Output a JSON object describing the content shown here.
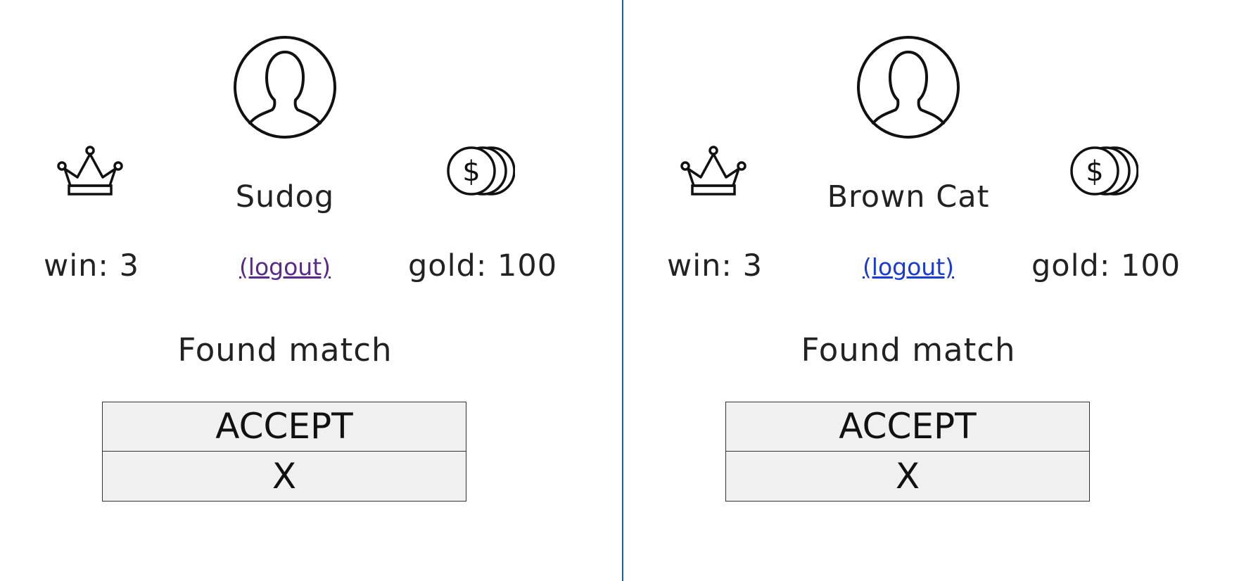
{
  "colors": {
    "divider": "#1f5f96",
    "button_bg": "#f0f0f0",
    "button_border": "#333333",
    "link_visited": "#5a2a8a",
    "link_unvisited": "#1a3bd8"
  },
  "panels": [
    {
      "username": "Sudog",
      "wins_text": "win: 3",
      "gold_text": "gold: 100",
      "logout_label": "(logout)",
      "status": "Found match",
      "accept_label": "ACCEPT",
      "decline_label": "X",
      "icons": {
        "avatar": "user-avatar-icon",
        "crown": "crown-icon",
        "coins": "coins-icon"
      }
    },
    {
      "username": "Brown Cat",
      "wins_text": "win: 3",
      "gold_text": "gold: 100",
      "logout_label": "(logout)",
      "status": "Found match",
      "accept_label": "ACCEPT",
      "decline_label": "X",
      "icons": {
        "avatar": "user-avatar-icon",
        "crown": "crown-icon",
        "coins": "coins-icon"
      }
    }
  ]
}
